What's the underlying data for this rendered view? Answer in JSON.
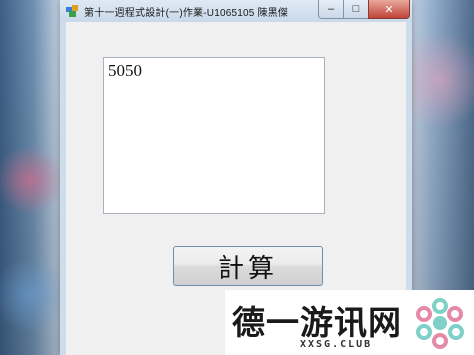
{
  "window": {
    "title": "第十一週程式設計(一)作業-U1065105 陳黑傑"
  },
  "title_controls": {
    "minimize": "–",
    "maximize": "□",
    "close": "✕"
  },
  "output": {
    "value": "5050"
  },
  "calculate_button": {
    "label": "計算"
  },
  "watermark": {
    "brand": "德一游讯网",
    "domain": "XXSG.CLUB"
  },
  "icons": {
    "app": "app-icon",
    "logo": "flower-logo-icon"
  }
}
